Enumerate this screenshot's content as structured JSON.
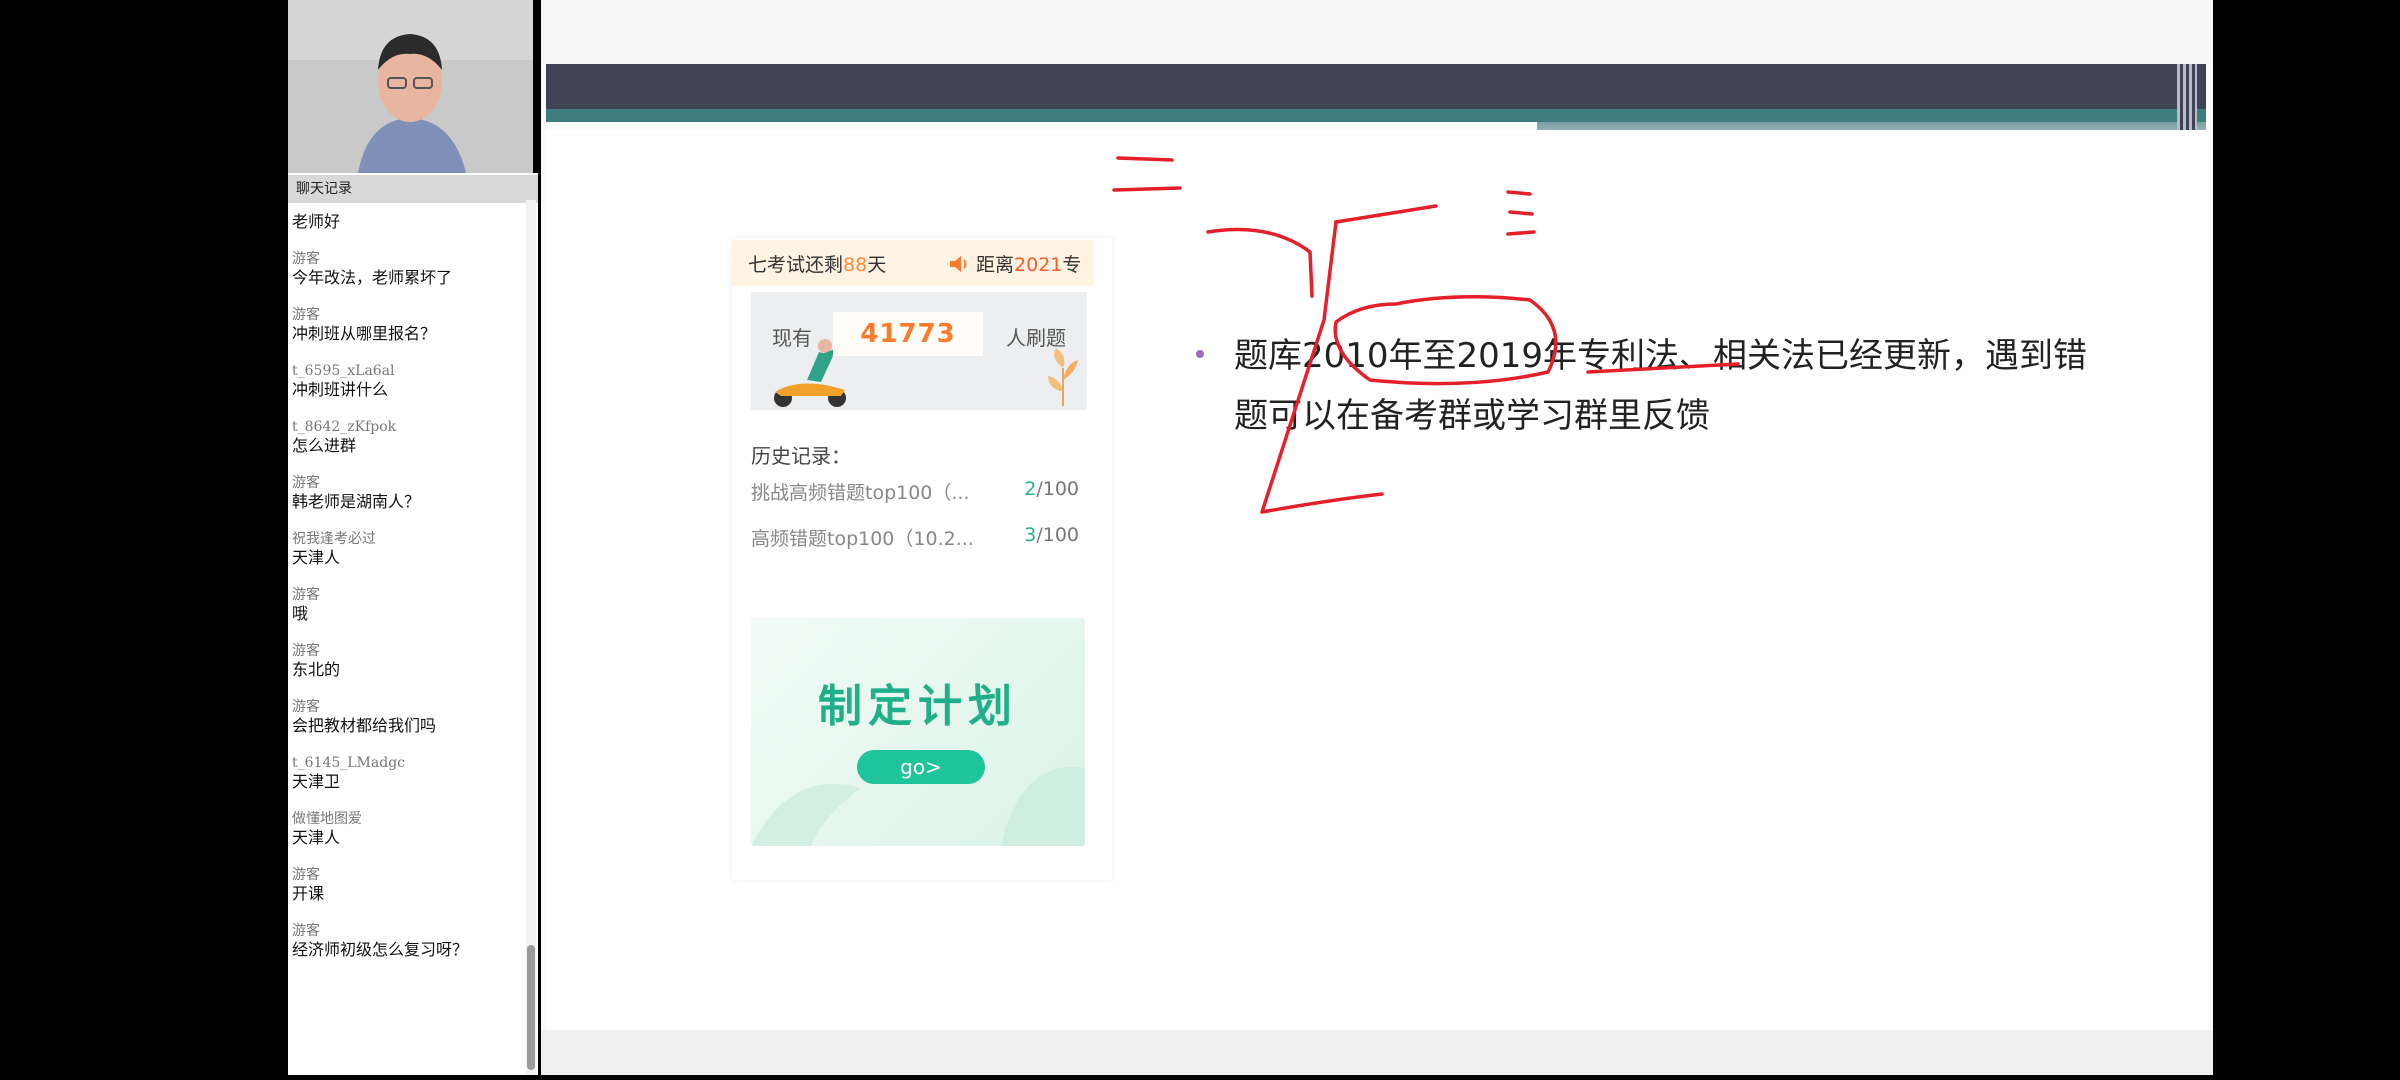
{
  "chat": {
    "header": "聊天记录",
    "messages": [
      {
        "user": "",
        "text": "老师好"
      },
      {
        "user": "游客",
        "text": "今年改法，老师累坏了"
      },
      {
        "user": "游客",
        "text": "冲刺班从哪里报名？"
      },
      {
        "user": "t_6595_xLa6al",
        "text": "冲刺班讲什么"
      },
      {
        "user": "t_8642_zKfpok",
        "text": "怎么进群"
      },
      {
        "user": "游客",
        "text": "韩老师是湖南人？"
      },
      {
        "user": "祝我逢考必过",
        "text": "天津人"
      },
      {
        "user": "游客",
        "text": "哦"
      },
      {
        "user": "游客",
        "text": "东北的"
      },
      {
        "user": "游客",
        "text": "会把教材都给我们吗"
      },
      {
        "user": "t_6145_LMadgc",
        "text": "天津卫"
      },
      {
        "user": "做懂地图爱",
        "text": "天津人"
      },
      {
        "user": "游客",
        "text": "开课"
      },
      {
        "user": "游客",
        "text": "经济师初级怎么复习呀？"
      }
    ]
  },
  "app": {
    "countdown_left_prefix": "七考试还剩",
    "countdown_left_days": "88",
    "countdown_left_suffix": "天",
    "countdown_right_prefix": "距离",
    "countdown_right_year": "2021",
    "countdown_right_suffix": "专",
    "banner_prefix": "现有",
    "banner_count": "41773",
    "banner_suffix": "人刷题",
    "history_title": "历史记录：",
    "history": [
      {
        "name": "挑战高频错题top100（...",
        "got": "2",
        "total": "/100"
      },
      {
        "name": "高频错题top100（10.2...",
        "got": "3",
        "total": "/100"
      }
    ],
    "plan_title": "制定计划",
    "plan_button": "go>"
  },
  "slide": {
    "bullet_line_1": "题库2010年至2019年专利法、相关法已经更新，遇到错",
    "bullet_line_2": "题可以在备考群或学习群里反馈"
  },
  "colors": {
    "header_band": "#3f4454",
    "teal_band": "#3d7d80",
    "annotation": "#e5202a",
    "accent_green": "#1fb08a",
    "accent_orange": "#ff7a2a"
  }
}
